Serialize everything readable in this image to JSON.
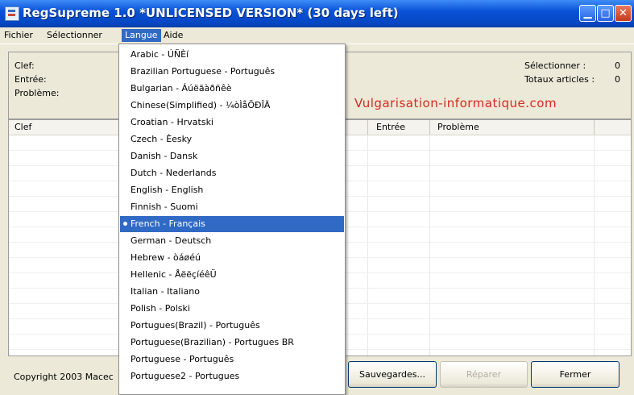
{
  "window": {
    "title": "RegSupreme 1.0  *UNLICENSED VERSION* (30 days left)",
    "minimize_glyph": "▁",
    "maximize_glyph": "□",
    "close_glyph": "✕",
    "titlebar_color": "#0a52d8"
  },
  "menu": {
    "fichier": "Fichier",
    "selectionner": "Sélectionner",
    "langue": "Langue",
    "aide": "Aide"
  },
  "info": {
    "clef": "Clef:",
    "entree": "Entrée:",
    "probleme": "Problème:",
    "selectionner_label": "Sélectionner :",
    "selectionner_value": "0",
    "totaux_label": "Totaux articles :",
    "totaux_value": "0",
    "watermark": "Vulgarisation-informatique.com"
  },
  "table": {
    "columns": [
      "Clef",
      "Entrée",
      "Problème"
    ]
  },
  "status": {
    "copyright": "Copyright 2003 Macec"
  },
  "buttons": {
    "sauvegardes": "Sauvegardes...",
    "reparer": "Réparer",
    "fermer": "Fermer"
  },
  "language_menu": [
    "Arabic - ÚÑÈí",
    "Brazilian Portuguese - Português",
    "Bulgarian - Áúëãàðñêè",
    "Chinese(Simplified) - ¼òÌåÖÐÎÄ",
    "Croatian - Hrvatski",
    "Czech - Èesky",
    "Danish - Dansk",
    "Dutch - Nederlands",
    "English - English",
    "Finnish - Suomi",
    "French - Français",
    "German - Deutsch",
    "Hebrew - òáøéú",
    "Hellenic - ÅëëçíéêÜ",
    "Italian - Italiano",
    "Polish - Polski",
    "Portugues(Brazil) - Português",
    "Portuguese(Brazilian) - Portugues BR",
    "Portuguese - Português",
    "Portuguese2 - Portugues"
  ],
  "selected_language": "French - Français",
  "accent_color": "#316ac5",
  "watermark_color": "#d42a1e"
}
